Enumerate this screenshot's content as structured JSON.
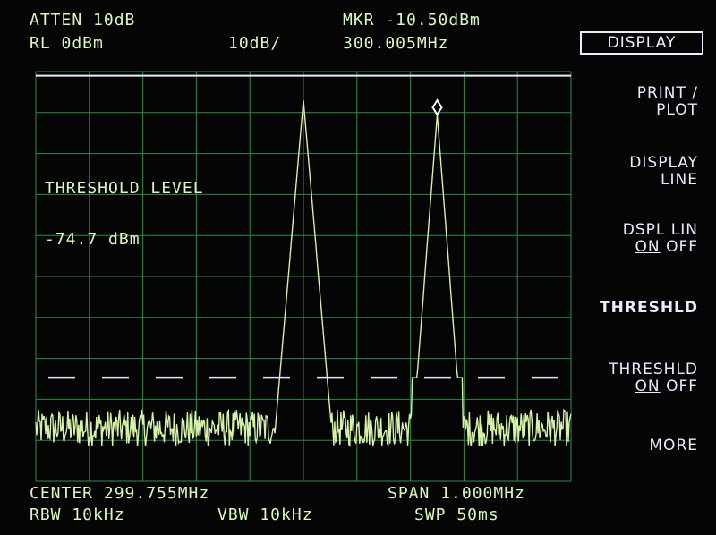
{
  "header": {
    "atten": "ATTEN 10dB",
    "ref_level": "RL 0dBm",
    "scale": "10dB/",
    "marker_amplitude": "MKR -10.50dBm",
    "marker_frequency": "300.005MHz"
  },
  "threshold_readout": {
    "title": "THRESHOLD LEVEL",
    "value": "-74.7 dBm"
  },
  "footer": {
    "center": "CENTER 299.755MHz",
    "span": "SPAN 1.000MHz",
    "rbw": "RBW 10kHz",
    "vbw": "VBW 10kHz",
    "sweep": "SWP 50ms"
  },
  "softkeys": {
    "display": "DISPLAY",
    "print_plot_1": "PRINT /",
    "print_plot_2": "PLOT",
    "display_line_1": "DISPLAY",
    "display_line_2": "LINE",
    "dspl_lin_1": "DSPL LIN",
    "dspl_lin_on": "ON",
    "dspl_lin_off": "OFF",
    "threshld": "THRESHLD",
    "threshld_onoff_1": "THRESHLD",
    "threshld_on": "ON",
    "threshld_off": "OFF",
    "more": "MORE"
  },
  "colors": {
    "trace": "#d6f2a6",
    "graticule": "#2f8a4a",
    "display_line": "#e8ecff",
    "threshold_line": "#e8ddff"
  },
  "chart_data": {
    "type": "line",
    "x_center_mhz": 299.755,
    "x_span_mhz": 1.0,
    "ylim": [
      -100,
      0
    ],
    "y_unit": "dBm",
    "reference_level_dbm": 0,
    "scale_db_per_div": 10,
    "display_line_dbm": -1,
    "threshold_dbm": -74.7,
    "noise_floor_dbm": -87,
    "peaks": [
      {
        "freq_mhz": 299.755,
        "amplitude_dbm": -7
      },
      {
        "freq_mhz": 300.005,
        "amplitude_dbm": -10.5
      }
    ],
    "marker": {
      "freq_mhz": 300.005,
      "amplitude_dbm": -10.5
    }
  }
}
